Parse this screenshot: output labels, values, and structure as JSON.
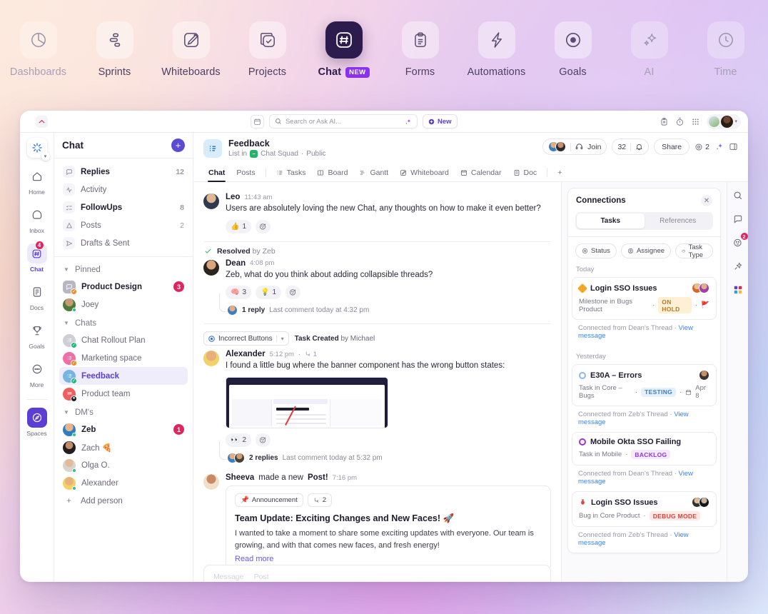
{
  "topnav": {
    "items": [
      {
        "label": "Dashboards",
        "icon": "pie-chart-icon",
        "state": "dim"
      },
      {
        "label": "Sprints",
        "icon": "sprints-icon",
        "state": "normal"
      },
      {
        "label": "Whiteboards",
        "icon": "whiteboard-pen-icon",
        "state": "normal"
      },
      {
        "label": "Projects",
        "icon": "projects-check-icon",
        "state": "normal"
      },
      {
        "label": "Chat",
        "icon": "chat-hash-icon",
        "state": "active",
        "badge": "NEW"
      },
      {
        "label": "Forms",
        "icon": "clipboard-icon",
        "state": "normal"
      },
      {
        "label": "Automations",
        "icon": "lightning-icon",
        "state": "normal"
      },
      {
        "label": "Goals",
        "icon": "target-icon",
        "state": "normal"
      },
      {
        "label": "AI",
        "icon": "sparkle-icon",
        "state": "dim"
      },
      {
        "label": "Time",
        "icon": "time-icon",
        "state": "dim"
      }
    ]
  },
  "titlebar": {
    "search_placeholder": "Search or Ask AI...",
    "new_label": "New",
    "calendar_icon": "calendar-icon",
    "search_icon": "search-icon",
    "ai_icon": "ai-sparkle-icon",
    "clipboard_icon": "clipboard-icon",
    "stopwatch_icon": "stopwatch-icon",
    "apps_icon": "apps-grid-icon"
  },
  "rail": {
    "items": [
      {
        "label": "Home",
        "icon": "home-icon"
      },
      {
        "label": "Inbox",
        "icon": "inbox-icon"
      },
      {
        "label": "Chat",
        "icon": "chat-hash-icon",
        "badge": "4",
        "active": true
      },
      {
        "label": "Docs",
        "icon": "docs-icon"
      },
      {
        "label": "Goals",
        "icon": "trophy-icon"
      },
      {
        "label": "More",
        "icon": "more-dots-icon"
      },
      {
        "label": "Spaces",
        "icon": "compass-icon",
        "purple": true
      }
    ]
  },
  "chatlist": {
    "title": "Chat",
    "add_label": "+",
    "nav": [
      {
        "label": "Replies",
        "count": "12",
        "bold": true,
        "icon": "reply-bubble-icon"
      },
      {
        "label": "Activity",
        "count": "",
        "bold": false,
        "icon": "activity-pulse-icon"
      },
      {
        "label": "FollowUps",
        "count": "8",
        "bold": true,
        "icon": "followups-icon"
      },
      {
        "label": "Posts",
        "count": "2",
        "bold": false,
        "icon": "posts-icon"
      },
      {
        "label": "Drafts & Sent",
        "count": "",
        "bold": false,
        "icon": "send-icon"
      }
    ],
    "groups": [
      {
        "label": "Pinned",
        "items": [
          {
            "label": "Product Design",
            "badge": "3",
            "bold": true,
            "avatar": "gray",
            "corner": "orange"
          },
          {
            "label": "Joey",
            "badge": "",
            "bold": false,
            "avatar": "photo-green"
          }
        ]
      },
      {
        "label": "Chats",
        "items": [
          {
            "label": "Chat Rollout Plan",
            "badge": "",
            "bold": false,
            "avatar": "gray-list",
            "corner": "green"
          },
          {
            "label": "Marketing space",
            "badge": "",
            "bold": false,
            "avatar": "pink-list",
            "corner": "orange"
          },
          {
            "label": "Feedback",
            "badge": "",
            "bold": false,
            "selected": true,
            "avatar": "blue-list",
            "corner": "green"
          },
          {
            "label": "Product team",
            "badge": "",
            "bold": false,
            "avatar": "red-list",
            "corner": "black"
          }
        ]
      },
      {
        "label": "DM's",
        "items": [
          {
            "label": "Zeb",
            "badge": "1",
            "bold": true,
            "avatar": "photo-blue"
          },
          {
            "label": "Zach 🍕",
            "badge": "",
            "bold": false,
            "avatar": "photo-dark"
          },
          {
            "label": "Olga O.",
            "badge": "",
            "bold": false,
            "avatar": "photo-olga"
          },
          {
            "label": "Alexander",
            "badge": "",
            "bold": false,
            "avatar": "photo-alex"
          }
        ]
      }
    ],
    "add_person": "Add person"
  },
  "mainhead": {
    "title": "Feedback",
    "subtitle_prefix": "List in",
    "space": "Chat Squad",
    "visibility": "Public",
    "join_label": "Join",
    "member_count": "32",
    "share_label": "Share",
    "watch_count": "2",
    "tabs": [
      {
        "label": "Chat",
        "active": true
      },
      {
        "label": "Posts",
        "active": false
      },
      {
        "label": "Tasks",
        "icon": "list-icon",
        "active": false
      },
      {
        "label": "Board",
        "icon": "board-icon",
        "active": false
      },
      {
        "label": "Gantt",
        "icon": "gantt-icon",
        "active": false
      },
      {
        "label": "Whiteboard",
        "icon": "whiteboard-pen-icon",
        "active": false
      },
      {
        "label": "Calendar",
        "icon": "calendar-icon",
        "active": false
      },
      {
        "label": "Doc",
        "icon": "doc-icon",
        "active": false
      },
      {
        "label": "+",
        "active": false
      }
    ]
  },
  "thread": {
    "messages": [
      {
        "author": "Leo",
        "time": "11:43 am",
        "text": "Users are absolutely loving the new Chat, any thoughts on how to make it even better?",
        "reactions": [
          {
            "emoji": "👍",
            "count": "1"
          }
        ]
      },
      {
        "resolved_label": "Resolved",
        "resolved_by": "by Zeb",
        "author": "Dean",
        "time": "4:08 pm",
        "text": "Zeb, what do you think about adding collapsible threads?",
        "reactions": [
          {
            "emoji": "🧠",
            "count": "3"
          },
          {
            "emoji": "💡",
            "count": "1"
          }
        ],
        "reply_count": "1 reply",
        "reply_meta": "Last comment today at 4:32 pm"
      },
      {
        "task_chip": "Incorrect Buttons",
        "task_note_prefix": "Task Created",
        "task_note_by": "by Michael",
        "author": "Alexander",
        "time": "5:12 pm",
        "thread_count": "1",
        "text": "I found a little bug where the banner component has the wrong button states:",
        "has_screenshot": true,
        "reactions": [
          {
            "emoji": "👀",
            "count": "2"
          }
        ],
        "reply_count": "2 replies",
        "reply_meta": "Last comment today at 5:32 pm"
      }
    ],
    "post": {
      "author": "Sheeva",
      "action": "made a new",
      "action_bold": "Post!",
      "time": "7:16 pm",
      "chip": "Announcement",
      "chip_icon": "📌",
      "thread_count": "2",
      "title": "Team Update: Exciting Changes and New Faces! 🚀",
      "body": "I wanted to take a moment to share some exciting updates with everyone. Our team is growing, and with that comes new faces, and fresh energy!",
      "read_more": "Read more"
    },
    "composer": {
      "message_tab": "Message",
      "post_tab": "Post"
    }
  },
  "connections": {
    "title": "Connections",
    "close_icon": "close-icon",
    "segments": [
      {
        "label": "Tasks",
        "active": true
      },
      {
        "label": "References",
        "active": false
      }
    ],
    "filters": [
      {
        "label": "Status",
        "icon": "status-icon"
      },
      {
        "label": "Assignee",
        "icon": "assignee-icon"
      },
      {
        "label": "Task Type",
        "icon": "task-type-icon"
      }
    ],
    "groups": [
      {
        "day": "Today",
        "items": [
          {
            "title": "Login SSO Issues",
            "dot_color": "#f5a623",
            "dot_shape": "diamond",
            "meta": "Milestone in Bugs Product",
            "status": "ON HOLD",
            "status_bg": "#fdf0d5",
            "status_color": "#b5792a",
            "flag": "🚩",
            "footer": "Connected from Dean's Thread",
            "link": "View message",
            "avatars": 2
          }
        ]
      },
      {
        "day": "Yesterday",
        "items": [
          {
            "title": "E30A – Errors",
            "dot_color": "#8fb8e8",
            "dot_shape": "circle",
            "meta": "Task in Core – Bugs",
            "status": "TESTING",
            "status_bg": "#e4f0fd",
            "status_color": "#3b7dc4",
            "date_icon": "calendar-icon",
            "date": "Apr 8",
            "footer": "Connected from Zeb's Thread",
            "link": "View message",
            "avatars": 1
          },
          {
            "title": "Mobile Okta SSO Failing",
            "dot_color": "#a033d6",
            "dot_shape": "circle",
            "meta": "Task in Mobile",
            "status": "BACKLOG",
            "status_bg": "#f6e8fd",
            "status_color": "#8b3fd0",
            "footer": "Connected from Dean's Thread",
            "link": "View message",
            "avatars": 0
          },
          {
            "title": "Login SSO Issues",
            "dot_color": "#e0443f",
            "dot_shape": "bug",
            "meta": "Bug in Core Product",
            "status": "DEBUG MODE",
            "status_bg": "#fde8e6",
            "status_color": "#d2453e",
            "footer": "Connected from Zeb's Thread",
            "link": "View message",
            "avatars": 2
          }
        ]
      }
    ]
  },
  "rightrail": {
    "items": [
      {
        "icon": "search-icon",
        "badge": ""
      },
      {
        "icon": "comment-bubble-icon",
        "badge": ""
      },
      {
        "icon": "emoji-reaction-icon",
        "badge": "2"
      },
      {
        "icon": "pin-icon",
        "badge": ""
      },
      {
        "icon": "apps-color-icon",
        "badge": ""
      }
    ]
  }
}
